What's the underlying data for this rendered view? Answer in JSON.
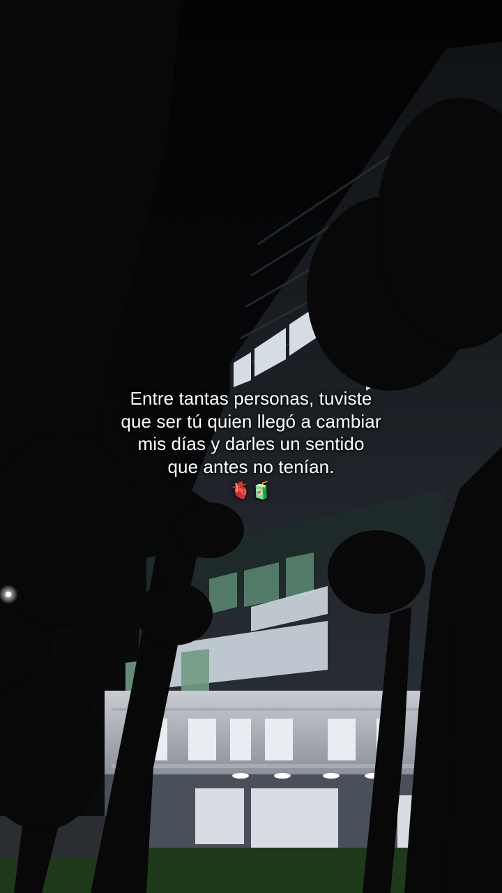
{
  "caption": {
    "lines": [
      "Entre tantas personas, tuviste",
      "que ser tú quien llegó a cambiar",
      "mis días y darles un sentido",
      "que antes no tenían."
    ],
    "emojis": "🫀🧃"
  },
  "scene": {
    "description_icons": [
      "building-photo",
      "palm-tree-silhouette"
    ],
    "colors": {
      "sky": "#050506",
      "building_lit": "#d9e3ea",
      "window_green": "#4f7a66",
      "tree": "#0b0c0b",
      "grass": "#1f3a1a"
    }
  }
}
